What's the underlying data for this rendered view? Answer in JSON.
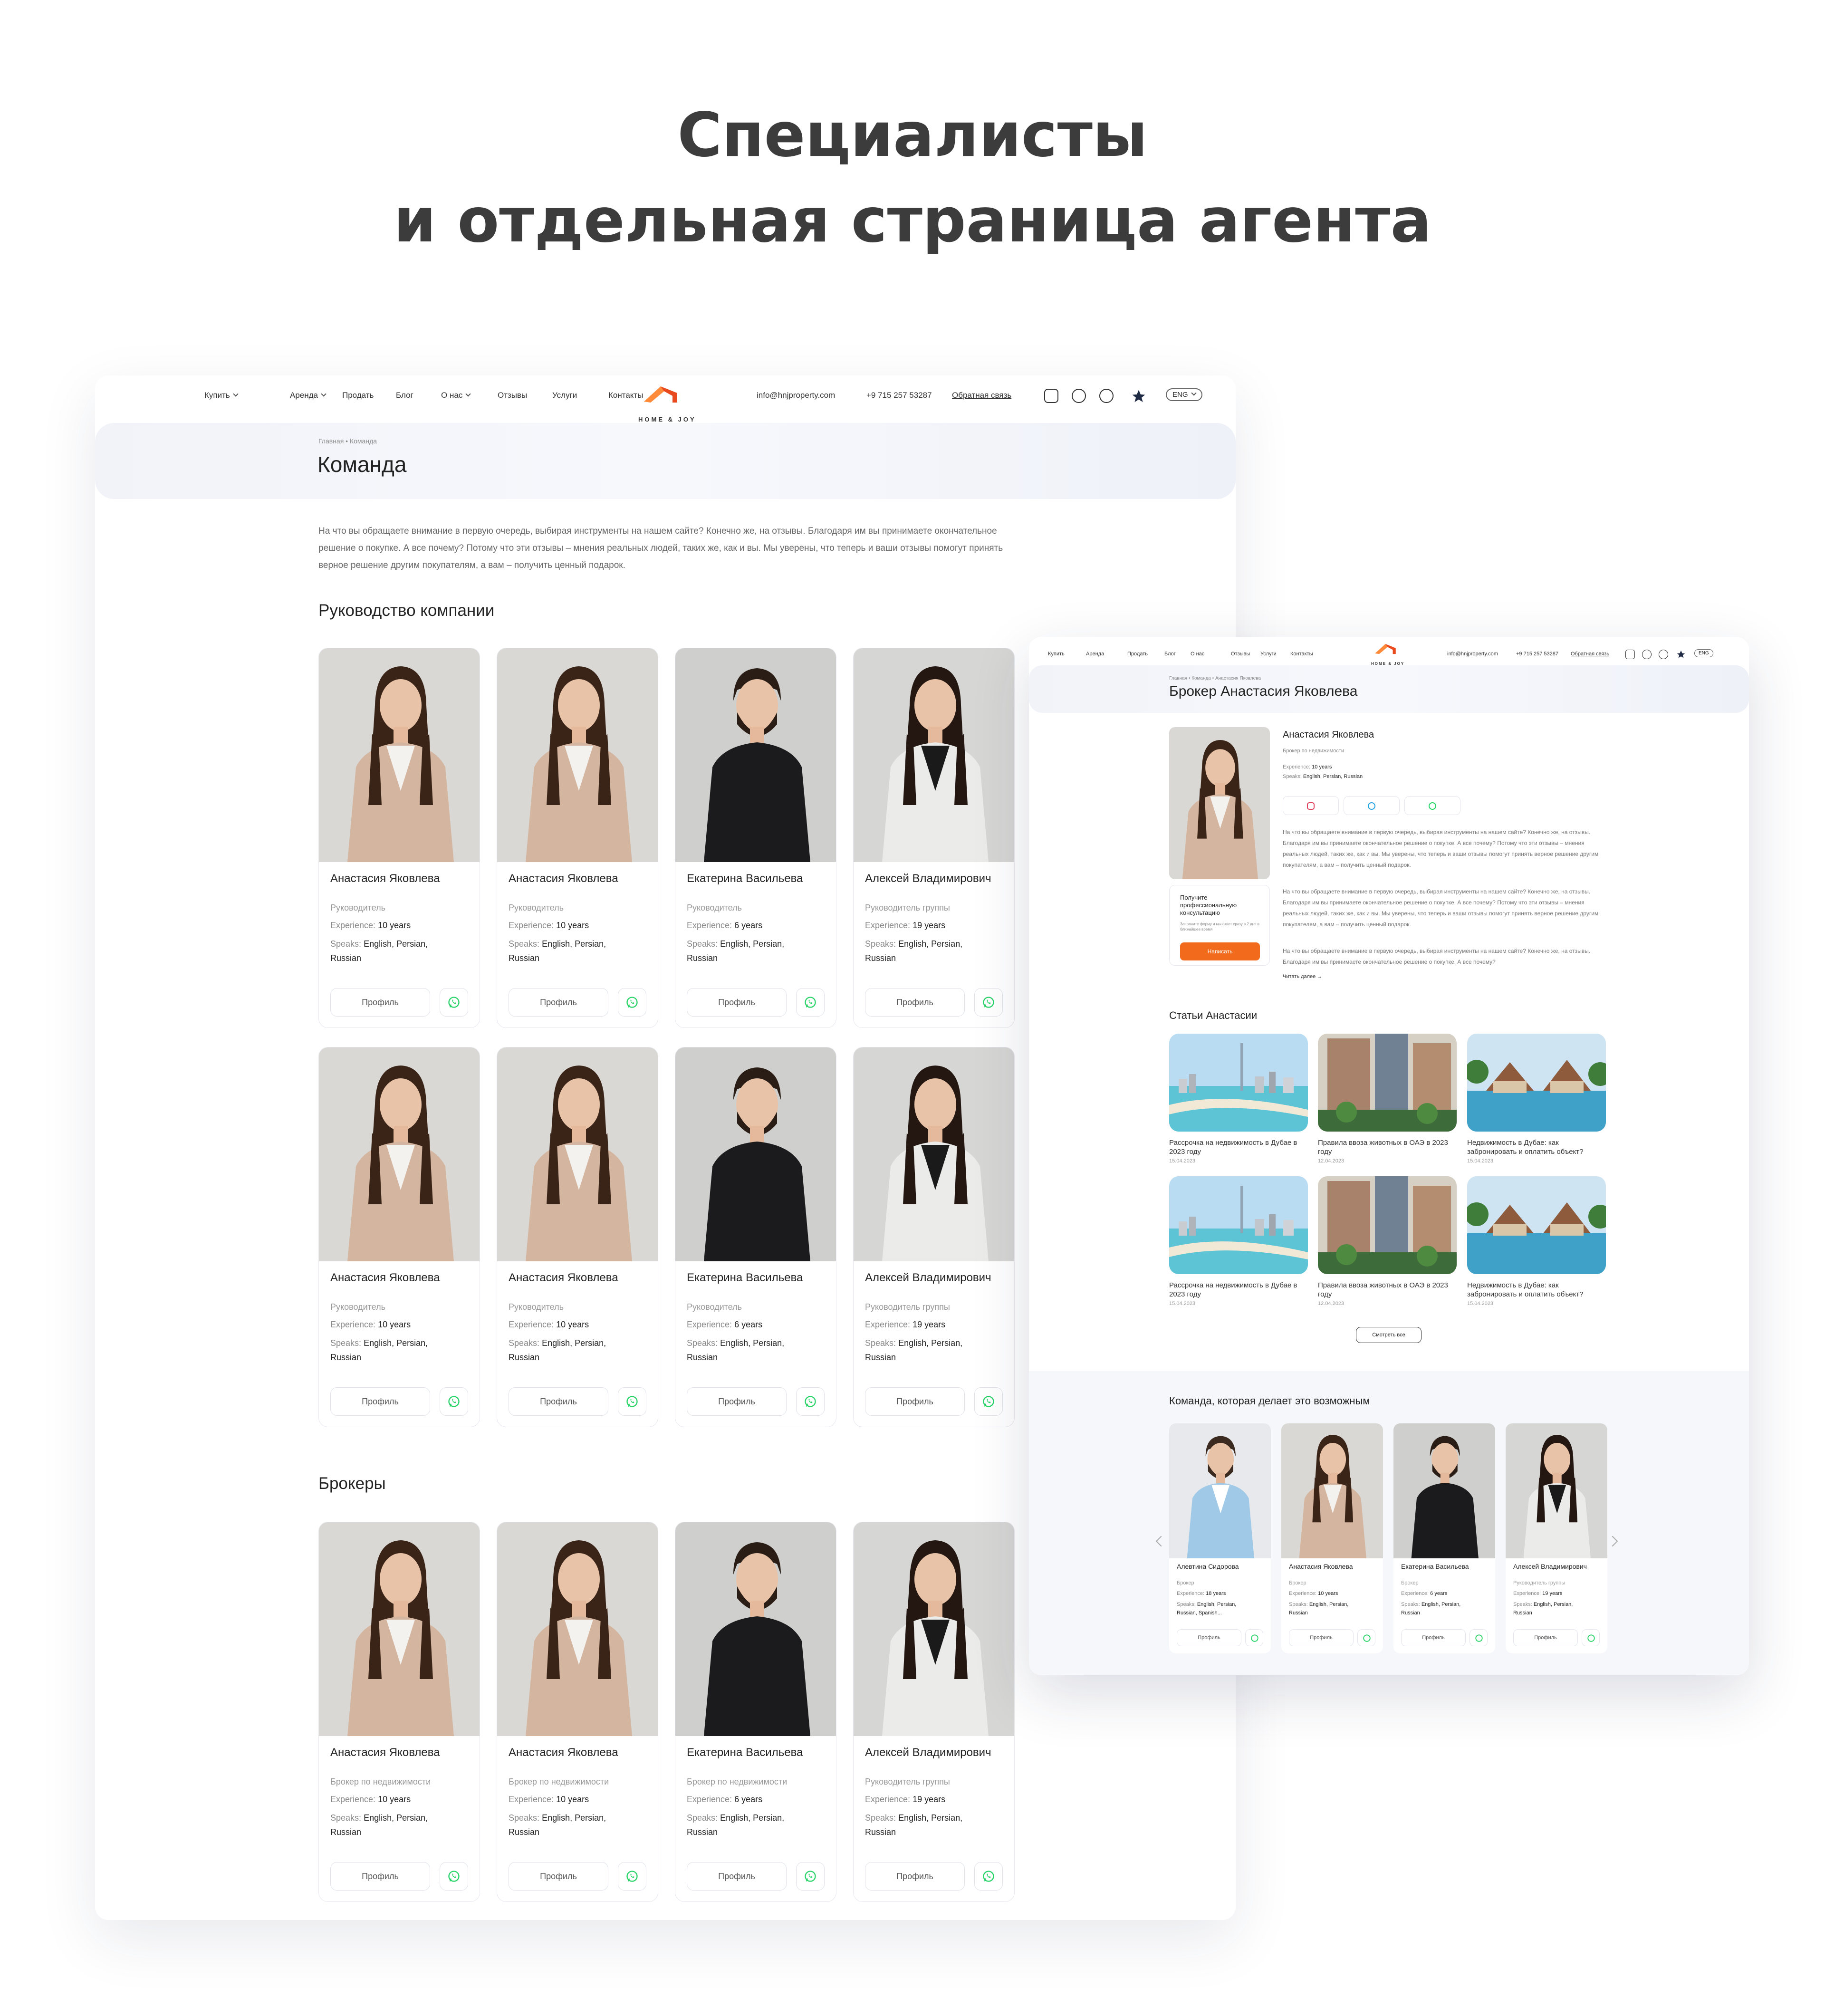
{
  "hero": {
    "line1": "Специалисты",
    "line2": "и отдельная страница агента"
  },
  "nav": {
    "items": [
      {
        "label": "Купить",
        "dropdown": true
      },
      {
        "label": "Аренда",
        "dropdown": true
      },
      {
        "label": "Продать",
        "dropdown": false
      },
      {
        "label": "Блог",
        "dropdown": false
      },
      {
        "label": "О нас",
        "dropdown": true
      },
      {
        "label": "Отзывы",
        "dropdown": false
      },
      {
        "label": "Услуги",
        "dropdown": false
      },
      {
        "label": "Контакты",
        "dropdown": false
      }
    ],
    "logo_text": "HOME & JOY",
    "email": "info@hnjproperty.com",
    "phone": "+9 715 257 53287",
    "feedback": "Обратная связь",
    "language": "ENG",
    "social_icons": [
      "instagram-icon",
      "telegram-icon",
      "whatsapp-icon"
    ],
    "favorites_icon": "star-icon"
  },
  "team_page": {
    "breadcrumb": [
      "Главная",
      "Команда"
    ],
    "title": "Команда",
    "intro": "На что вы обращаете внимание в первую очередь, выбирая инструменты на нашем сайте? Конечно же, на отзывы. Благодаря им вы принимаете окончательное решение о покупке.  А все почему? Потому что эти отзывы – мнения реальных людей, таких же, как и вы. Мы уверены, что теперь и ваши отзывы помогут принять верное решение другим покупателям, а вам – получить ценный подарок.",
    "section_management": "Руководство компании",
    "section_brokers": "Брокеры",
    "profile_label": "Профиль",
    "experience_label": "Experience:",
    "speaks_label": "Speaks:",
    "management": [
      {
        "name": "Анастасия Яковлева",
        "role": "Руководитель",
        "experience": "10 years",
        "speaks": "English, Persian, Russian",
        "photo": "woman-beige"
      },
      {
        "name": "Анастасия Яковлева",
        "role": "Руководитель",
        "experience": "10 years",
        "speaks": "English, Persian, Russian",
        "photo": "woman-beige"
      },
      {
        "name": "Екатерина Васильева",
        "role": "Руководитель",
        "experience": "6 years",
        "speaks": "English, Persian, Russian",
        "photo": "man-black"
      },
      {
        "name": "Алексей Владимирович",
        "role": "Руководитель группы",
        "experience": "19 years",
        "speaks": "English, Persian, Russian",
        "photo": "woman-white"
      },
      {
        "name": "Анастасия Яковлева",
        "role": "Руководитель",
        "experience": "10 years",
        "speaks": "English, Persian, Russian",
        "photo": "woman-beige"
      },
      {
        "name": "Анастасия Яковлева",
        "role": "Руководитель",
        "experience": "10 years",
        "speaks": "English, Persian, Russian",
        "photo": "woman-beige"
      },
      {
        "name": "Екатерина Васильева",
        "role": "Руководитель",
        "experience": "6 years",
        "speaks": "English, Persian, Russian",
        "photo": "man-black"
      },
      {
        "name": "Алексей Владимирович",
        "role": "Руководитель группы",
        "experience": "19 years",
        "speaks": "English, Persian, Russian",
        "photo": "woman-white"
      }
    ],
    "brokers": [
      {
        "name": "Анастасия Яковлева",
        "role": "Брокер по недвижимости",
        "experience": "10 years",
        "speaks": "English, Persian, Russian",
        "photo": "woman-beige"
      },
      {
        "name": "Анастасия Яковлева",
        "role": "Брокер по недвижимости",
        "experience": "10 years",
        "speaks": "English, Persian, Russian",
        "photo": "woman-beige"
      },
      {
        "name": "Екатерина Васильева",
        "role": "Брокер по недвижимости",
        "experience": "6 years",
        "speaks": "English, Persian, Russian",
        "photo": "man-black"
      },
      {
        "name": "Алексей Владимирович",
        "role": "Руководитель группы",
        "experience": "19 years",
        "speaks": "English, Persian, Russian",
        "photo": "woman-white"
      }
    ]
  },
  "agent_page": {
    "breadcrumb": [
      "Главная",
      "Команда",
      "Анастасия Яковлева"
    ],
    "title": "Брокер Анастасия Яковлева",
    "name": "Анастасия Яковлева",
    "role": "Брокер по недвижимости",
    "experience": "10 years",
    "speaks": "English, Persian, Russian",
    "bio": [
      "На что вы обращаете внимание в первую очередь, выбирая инструменты на нашем сайте? Конечно же, на отзывы. Благодаря им вы принимаете окончательное решение о покупке.  А все почему? Потому что эти отзывы – мнения реальных людей, таких же, как и вы. Мы уверены, что теперь и ваши отзывы помогут принять верное решение другим покупателям, а вам – получить ценный подарок.",
      "На что вы обращаете внимание в первую очередь, выбирая инструменты на нашем сайте? Конечно же, на отзывы. Благодаря им вы принимаете окончательное решение о покупке.  А все почему? Потому что эти отзывы – мнения реальных людей, таких же, как и вы. Мы уверены, что теперь и ваши отзывы помогут принять верное решение другим покупателям, а вам – получить ценный подарок.",
      "На что вы обращаете внимание в первую очередь, выбирая инструменты на нашем сайте? Конечно же, на отзывы. Благодаря им вы принимаете окончательное решение о покупке.  А все почему?"
    ],
    "read_more": "Читать далее →",
    "consult_title": "Получите профессиональную консультацию",
    "consult_text": "Заполните форму и мы ответ сразу в 2 дня в ближайшее время",
    "consult_button": "Написать",
    "articles_title": "Статьи Анастасии",
    "articles": [
      {
        "title": "Рассрочка на недвижимость в Дубае в 2023 году",
        "date": "15.04.2023",
        "image": "skyline"
      },
      {
        "title": "Правила ввоза животных в ОАЭ в 2023 году",
        "date": "12.04.2023",
        "image": "towers"
      },
      {
        "title": "Недвижимость в Дубае: как забронировать и оплатить объект?",
        "date": "15.04.2023",
        "image": "resort"
      },
      {
        "title": "Рассрочка на недвижимость в Дубае в 2023 году",
        "date": "15.04.2023",
        "image": "skyline"
      },
      {
        "title": "Правила ввоза животных в ОАЭ в 2023 году",
        "date": "12.04.2023",
        "image": "towers"
      },
      {
        "title": "Недвижимость в Дубае: как забронировать и оплатить объект?",
        "date": "15.04.2023",
        "image": "resort"
      }
    ],
    "see_all": "Смотреть все",
    "team_title": "Команда, которая делает это возможным",
    "team": [
      {
        "name": "Алевтина Сидорова",
        "role": "Брокер",
        "experience": "18 years",
        "speaks": "English, Persian, Russian, Spanish...",
        "photo": "man-blue"
      },
      {
        "name": "Анастасия Яковлева",
        "role": "Брокер",
        "experience": "10 years",
        "speaks": "English, Persian, Russian",
        "photo": "woman-beige"
      },
      {
        "name": "Екатерина Васильева",
        "role": "Брокер",
        "experience": "6 years",
        "speaks": "English, Persian, Russian",
        "photo": "man-black"
      },
      {
        "name": "Алексей Владимирович",
        "role": "Руководитель группы",
        "experience": "19 years",
        "speaks": "English, Persian, Russian",
        "photo": "woman-white"
      }
    ]
  },
  "colors": {
    "accent_orange": "#f26a1b",
    "whatsapp_green": "#25d366",
    "text_dark": "#222222",
    "banner_bg": "#f1f3f9"
  }
}
